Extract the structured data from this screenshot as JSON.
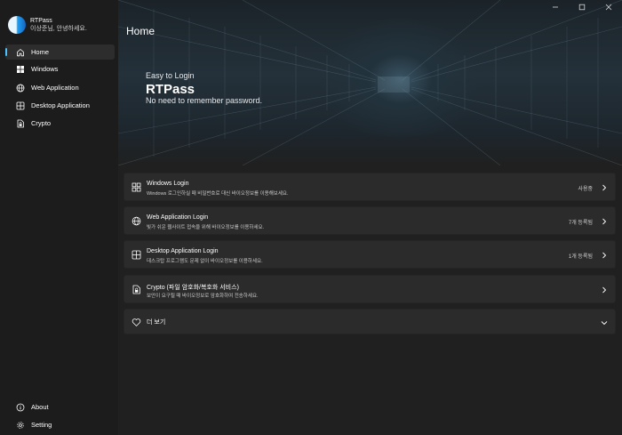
{
  "profile": {
    "name": "RTPass",
    "greeting": "이상준님, 안녕하세요."
  },
  "nav": {
    "items": [
      {
        "label": "Home",
        "icon": "home-icon",
        "active": true
      },
      {
        "label": "Windows",
        "icon": "windows-icon"
      },
      {
        "label": "Web Application",
        "icon": "globe-icon"
      },
      {
        "label": "Desktop Application",
        "icon": "desktop-app-icon"
      },
      {
        "label": "Crypto",
        "icon": "crypto-icon"
      }
    ],
    "footer": [
      {
        "label": "About",
        "icon": "info-icon"
      },
      {
        "label": "Setting",
        "icon": "gear-icon"
      }
    ]
  },
  "page": {
    "title": "Home"
  },
  "hero": {
    "subtitle": "Easy to Login",
    "title": "RTPass",
    "description": "No need to remember password."
  },
  "cards": [
    {
      "title": "Windows Login",
      "desc": "Windows 로그인하실 때 비밀번호로 대신 바이오정보를 이용해보세요.",
      "status": "사용중",
      "icon": "windows-icon"
    },
    {
      "title": "Web Application Login",
      "desc": "빛가 쉬운 웹사이트 접속을 위해 바이오정보를 이용하세요.",
      "status": "7개 등록됨",
      "icon": "globe-icon"
    },
    {
      "title": "Desktop Application Login",
      "desc": "데스크탑 프로그램도 문제 없이 바이오정보를 이용하세요.",
      "status": "1개 등록됨",
      "icon": "desktop-app-icon"
    },
    {
      "title": "Crypto (파일 암호화/복호화 서비스)",
      "desc": "보안이 요구될 때 바이오정보로 암호화하여 전송하세요.",
      "status": "",
      "icon": "crypto-icon"
    }
  ],
  "more": {
    "label": "더 보기",
    "icon": "heart-icon"
  },
  "colors": {
    "accent": "#4cc2ff",
    "sidebar": "#1c1c1c",
    "background": "#202020",
    "card": "#2b2b2b"
  }
}
